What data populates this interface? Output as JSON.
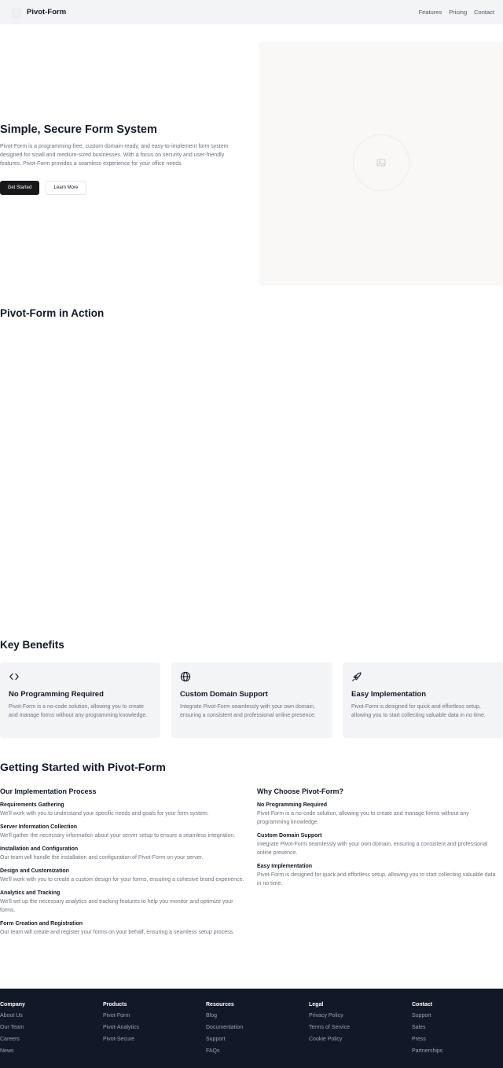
{
  "header": {
    "brand": "Pivot-Form",
    "nav": [
      "Features",
      "Pricing",
      "Contact"
    ]
  },
  "hero": {
    "title": "Simple, Secure Form System",
    "description": "Pivot-Form is a programming-free, custom domain-ready, and easy-to-implement form system designed for small and medium-sized businesses. With a focus on security and user-friendly features, Pivot-Form provides a seamless experience for your office needs.",
    "primary_button": "Get Started",
    "secondary_button": "Learn More",
    "media_icon": "image-placeholder-icon"
  },
  "action": {
    "title": "Pivot-Form in Action"
  },
  "benefits": {
    "title": "Key Benefits",
    "cards": [
      {
        "icon": "code-icon",
        "title": "No Programming Required",
        "description": "Pivot-Form is a no-code solution, allowing you to create and manage forms without any programming knowledge."
      },
      {
        "icon": "globe-icon",
        "title": "Custom Domain Support",
        "description": "Integrate Pivot-Form seamlessly with your own domain, ensuring a consistent and professional online presence."
      },
      {
        "icon": "rocket-icon",
        "title": "Easy Implementation",
        "description": "Pivot-Form is designed for quick and effortless setup, allowing you to start collecting valuable data in no time."
      }
    ]
  },
  "getting_started": {
    "title": "Getting Started with Pivot-Form",
    "process": {
      "heading": "Our Implementation Process",
      "items": [
        {
          "title": "Requirements Gathering",
          "description": "We'll work with you to understand your specific needs and goals for your form system."
        },
        {
          "title": "Server Information Collection",
          "description": "We'll gather the necessary information about your server setup to ensure a seamless integration."
        },
        {
          "title": "Installation and Configuration",
          "description": "Our team will handle the installation and configuration of Pivot-Form on your server."
        },
        {
          "title": "Design and Customization",
          "description": "We'll work with you to create a custom design for your forms, ensuring a cohesive brand experience."
        },
        {
          "title": "Analytics and Tracking",
          "description": "We'll set up the necessary analytics and tracking features to help you monitor and optimize your forms."
        },
        {
          "title": "Form Creation and Registration",
          "description": "Our team will create and register your forms on your behalf, ensuring a seamless setup process."
        }
      ]
    },
    "why": {
      "heading": "Why Choose Pivot-Form?",
      "items": [
        {
          "title": "No Programming Required",
          "description": "Pivot-Form is a no-code solution, allowing you to create and manage forms without any programming knowledge."
        },
        {
          "title": "Custom Domain Support",
          "description": "Integrate Pivot-Form seamlessly with your own domain, ensuring a consistent and professional online presence."
        },
        {
          "title": "Easy Implementation",
          "description": "Pivot-Form is designed for quick and effortless setup, allowing you to start collecting valuable data in no time."
        }
      ]
    }
  },
  "footer": {
    "columns": [
      {
        "title": "Company",
        "links": [
          "About Us",
          "Our Team",
          "Careers",
          "News"
        ]
      },
      {
        "title": "Products",
        "links": [
          "Pivot-Form",
          "Pivot-Analytics",
          "Pivot-Secure"
        ]
      },
      {
        "title": "Resources",
        "links": [
          "Blog",
          "Documentation",
          "Support",
          "FAQs"
        ]
      },
      {
        "title": "Legal",
        "links": [
          "Privacy Policy",
          "Terms of Service",
          "Cookie Policy"
        ]
      },
      {
        "title": "Contact",
        "links": [
          "Support",
          "Sales",
          "Press",
          "Partnerships"
        ]
      }
    ]
  },
  "colors": {
    "dark": "#111827",
    "muted": "#6b7280",
    "card_bg": "#f3f4f6",
    "button_dark": "#18181b"
  }
}
